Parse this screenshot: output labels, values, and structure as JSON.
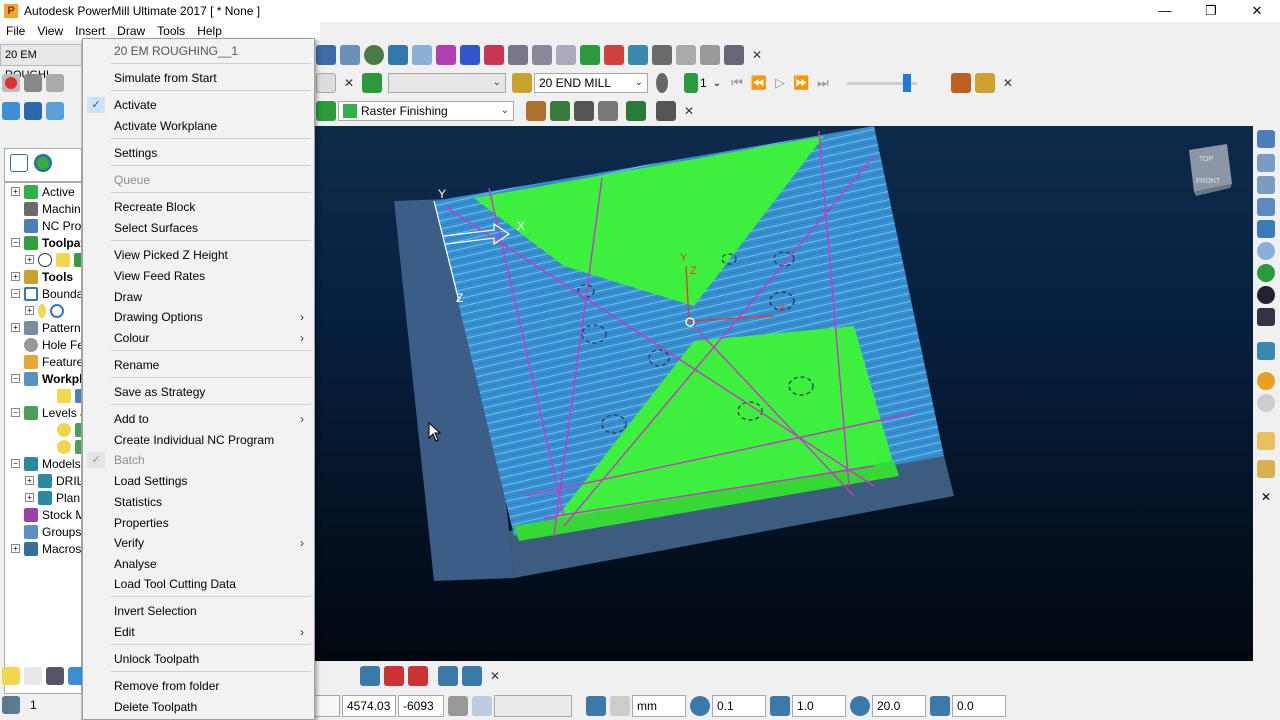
{
  "window": {
    "title": "Autodesk PowerMill Ultimate 2017    [ * None ]",
    "minimize": "—",
    "maximize": "❐",
    "close": "✕"
  },
  "menubar": [
    "File",
    "View",
    "Insert",
    "Draw",
    "Tools",
    "Help"
  ],
  "left_panel": {
    "toolpath_tab": "20 EM ROUGHI",
    "explorer_items": [
      {
        "label": "Active",
        "bold": false
      },
      {
        "label": "Machin",
        "bold": false
      },
      {
        "label": "NC Pro",
        "bold": false
      },
      {
        "label": "Toolpat",
        "bold": true
      },
      {
        "label": "",
        "bold": false
      },
      {
        "label": "Tools",
        "bold": true
      },
      {
        "label": "Bounda",
        "bold": false
      },
      {
        "label": "",
        "bold": false
      },
      {
        "label": "Patterns",
        "bold": false
      },
      {
        "label": "Hole Fe",
        "bold": false
      },
      {
        "label": "Feature",
        "bold": false
      },
      {
        "label": "Workpl",
        "bold": true
      },
      {
        "label": "",
        "bold": false
      },
      {
        "label": "Levels a",
        "bold": false
      },
      {
        "label": "",
        "bold": false
      },
      {
        "label": "",
        "bold": false
      },
      {
        "label": "Models",
        "bold": false
      },
      {
        "label": "DRIL",
        "bold": false
      },
      {
        "label": "Plan",
        "bold": false
      },
      {
        "label": "Stock M",
        "bold": false
      },
      {
        "label": "Groups",
        "bold": false
      },
      {
        "label": "Macros",
        "bold": false
      }
    ],
    "bottom_value": "1"
  },
  "toolbar": {
    "tool_name": "20 END MILL",
    "strategy": "Raster Finishing",
    "tool_number": "1"
  },
  "status": {
    "x": "4574.03",
    "y": "-6093",
    "units": "mm",
    "tolerance": "0.1",
    "thickness": "1.0",
    "diameter": "20.0",
    "angle": "0.0"
  },
  "viewcube": {
    "top": "TOP",
    "front": "FRONT"
  },
  "axes": {
    "y": "Y",
    "x": "X",
    "z": "Z"
  },
  "context_menu": {
    "header": "20 EM ROUGHING__1",
    "items": [
      {
        "label": "Simulate from Start"
      },
      {
        "label": "Activate",
        "checked": true
      },
      {
        "label": "Activate Workplane"
      },
      {
        "label": "Settings"
      },
      {
        "label": "Queue",
        "disabled": true
      },
      {
        "label": "Recreate Block"
      },
      {
        "label": "Select Surfaces"
      },
      {
        "label": "View Picked Z Height"
      },
      {
        "label": "View Feed Rates"
      },
      {
        "label": "Draw"
      },
      {
        "label": "Drawing Options",
        "submenu": true
      },
      {
        "label": "Colour",
        "submenu": true
      },
      {
        "label": "Rename"
      },
      {
        "label": "Save as Strategy"
      },
      {
        "label": "Add to",
        "submenu": true
      },
      {
        "label": "Create Individual NC Program"
      },
      {
        "label": "Batch",
        "disabled": true,
        "checked": true
      },
      {
        "label": "Load Settings"
      },
      {
        "label": "Statistics"
      },
      {
        "label": "Properties"
      },
      {
        "label": "Verify",
        "submenu": true
      },
      {
        "label": "Analyse"
      },
      {
        "label": "Load Tool Cutting Data"
      },
      {
        "label": "Invert Selection"
      },
      {
        "label": "Edit",
        "submenu": true
      },
      {
        "label": "Unlock Toolpath"
      },
      {
        "label": "Remove from folder"
      },
      {
        "label": "Delete Toolpath"
      }
    ],
    "submenu_glyph": "›",
    "check_glyph": "✓"
  }
}
